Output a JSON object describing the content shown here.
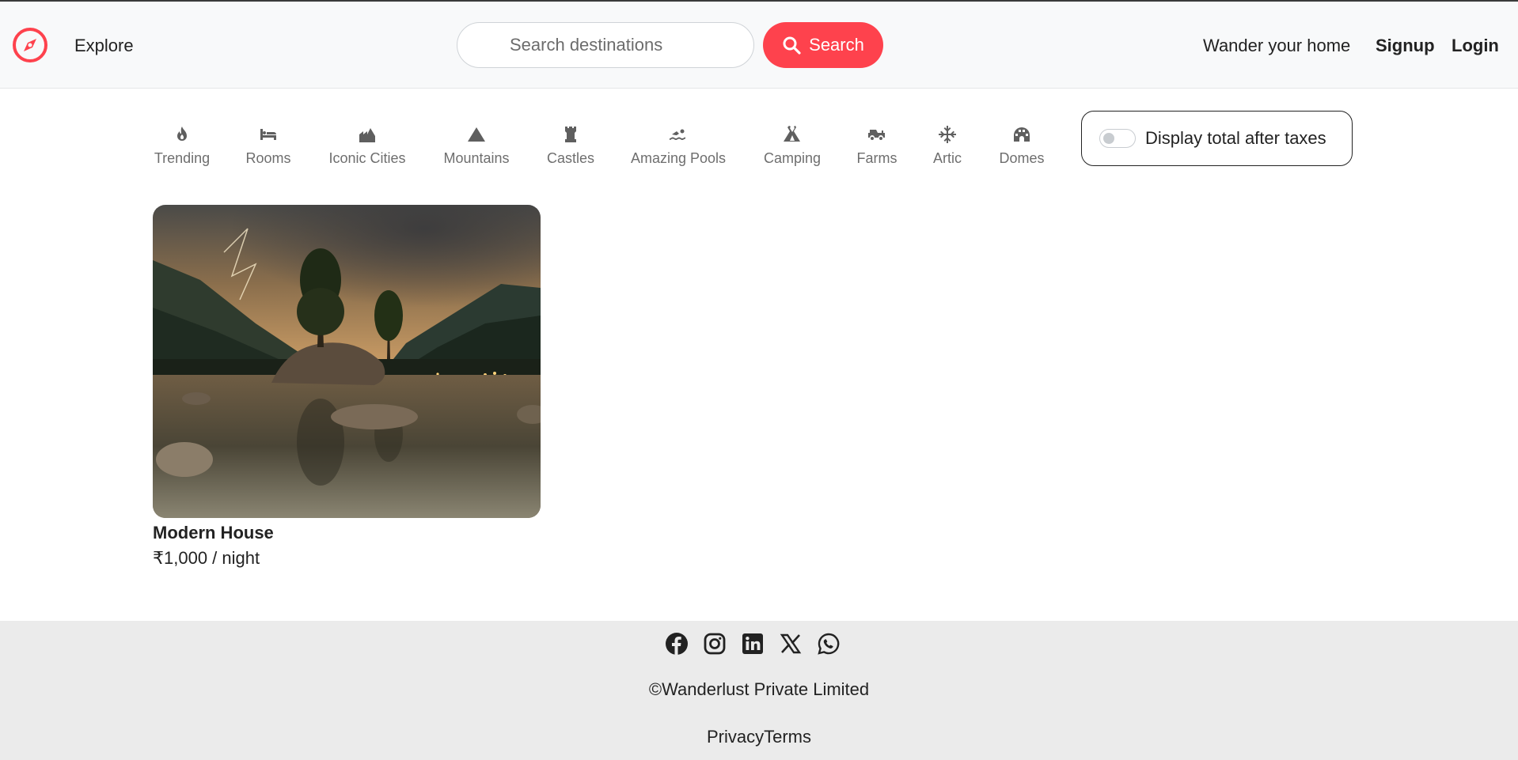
{
  "navbar": {
    "explore_label": "Explore",
    "search_placeholder": "Search destinations",
    "search_button_label": "Search",
    "wander_label": "Wander your home",
    "signup_label": "Signup",
    "login_label": "Login",
    "brand_color": "#fe424d"
  },
  "filters": [
    {
      "label": "Trending",
      "icon": "fire-icon"
    },
    {
      "label": "Rooms",
      "icon": "bed-icon"
    },
    {
      "label": "Iconic Cities",
      "icon": "city-icon"
    },
    {
      "label": "Mountains",
      "icon": "mountain-icon"
    },
    {
      "label": "Castles",
      "icon": "castle-icon"
    },
    {
      "label": "Amazing Pools",
      "icon": "swimmer-icon"
    },
    {
      "label": "Camping",
      "icon": "tent-icon"
    },
    {
      "label": "Farms",
      "icon": "tractor-icon"
    },
    {
      "label": "Artic",
      "icon": "snowflake-icon"
    },
    {
      "label": "Domes",
      "icon": "igloo-icon"
    }
  ],
  "tax_toggle": {
    "label": "Display total after taxes",
    "enabled": false
  },
  "listings": [
    {
      "title": "Modern House",
      "price": "₹1,000 / night"
    }
  ],
  "footer": {
    "socials": [
      "facebook-icon",
      "instagram-icon",
      "linkedin-icon",
      "x-icon",
      "whatsapp-icon"
    ],
    "copyright": "©Wanderlust Private Limited",
    "privacy_label": "Privacy",
    "terms_label": "Terms"
  }
}
